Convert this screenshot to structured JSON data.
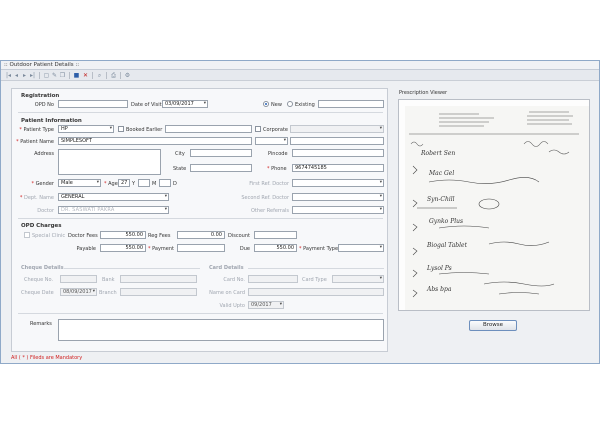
{
  "window": {
    "title": ":: Outdoor Patient Details ::"
  },
  "toolbar": {
    "icons": [
      "first-icon",
      "previous-icon",
      "next-icon",
      "last-icon",
      "new-icon",
      "edit-icon",
      "save-icon",
      "delete-icon",
      "search-icon",
      "print-icon",
      "settings-icon"
    ]
  },
  "registration": {
    "section": "Registration",
    "opd_no_label": "OPD No",
    "opd_no": "",
    "date_label": "Date of Visit",
    "date": "03/09/2017",
    "new_label": "New",
    "existing_label": "Existing",
    "selected": "New",
    "existing_value": ""
  },
  "patient": {
    "section": "Patient Information",
    "type_label": "Patient Type",
    "type": "HP",
    "booked_label": "Booked Earlier",
    "booked_value": "",
    "corporate_label": "Corporate",
    "name_label": "Patient Name",
    "name": "SIMPLESOFT",
    "name_extra": "",
    "address_label": "Address",
    "address": "",
    "city_label": "City",
    "city": "",
    "pincode_label": "Pincode",
    "pincode": "",
    "state_label": "State",
    "state": "",
    "phone_label": "Phone",
    "phone": "9674745185",
    "gender_label": "Gender",
    "gender": "Male",
    "age_label": "Age",
    "age_y": "27",
    "y": "Y",
    "m": "M",
    "d": "D",
    "first_ref_label": "First Ref. Doctor",
    "dept_label": "Dept. Name",
    "dept": "GENERAL",
    "second_ref_label": "Second Ref. Doctor",
    "doctor_label": "Doctor",
    "doctor": "DR. SASWATI PAKRA",
    "other_ref_label": "Other Referrals"
  },
  "charges": {
    "section": "OPD Charges",
    "special_label": "Special Clinic",
    "doctor_fees_label": "Doctor Fees",
    "doctor_fees": "550.00",
    "reg_fees_label": "Reg Fees",
    "reg_fees": "0.00",
    "discount_label": "Discount",
    "discount": "",
    "payable_label": "Payable",
    "payable": "550.00",
    "payment_label": "Payment",
    "payment": "",
    "due_label": "Due",
    "due": "550.00",
    "payment_type_label": "Payment Type",
    "payment_type": ""
  },
  "cheque": {
    "section": "Cheque Details",
    "no_label": "Cheque No.",
    "bank_label": "Bank",
    "date_label": "Cheque Date",
    "date": "08/09/2017",
    "branch_label": "Branch"
  },
  "card": {
    "section": "Card Details",
    "no_label": "Card No.",
    "type_label": "Card Type",
    "name_label": "Name on Card",
    "valid_label": "Valid Upto",
    "valid": "09/2017"
  },
  "remarks": {
    "label": "Remarks",
    "value": ""
  },
  "footer": {
    "mandatory": "All ( * ) Fileds are Mandatory"
  },
  "prescription": {
    "title": "Prescription Viewer",
    "browse": "Browse",
    "lines": [
      "Robert Sen",
      "Mac Gel",
      "Syn-Chill",
      "Gynko Plus",
      "Biogal Tablet",
      "Lysol Ps",
      "Abs bpa"
    ]
  }
}
